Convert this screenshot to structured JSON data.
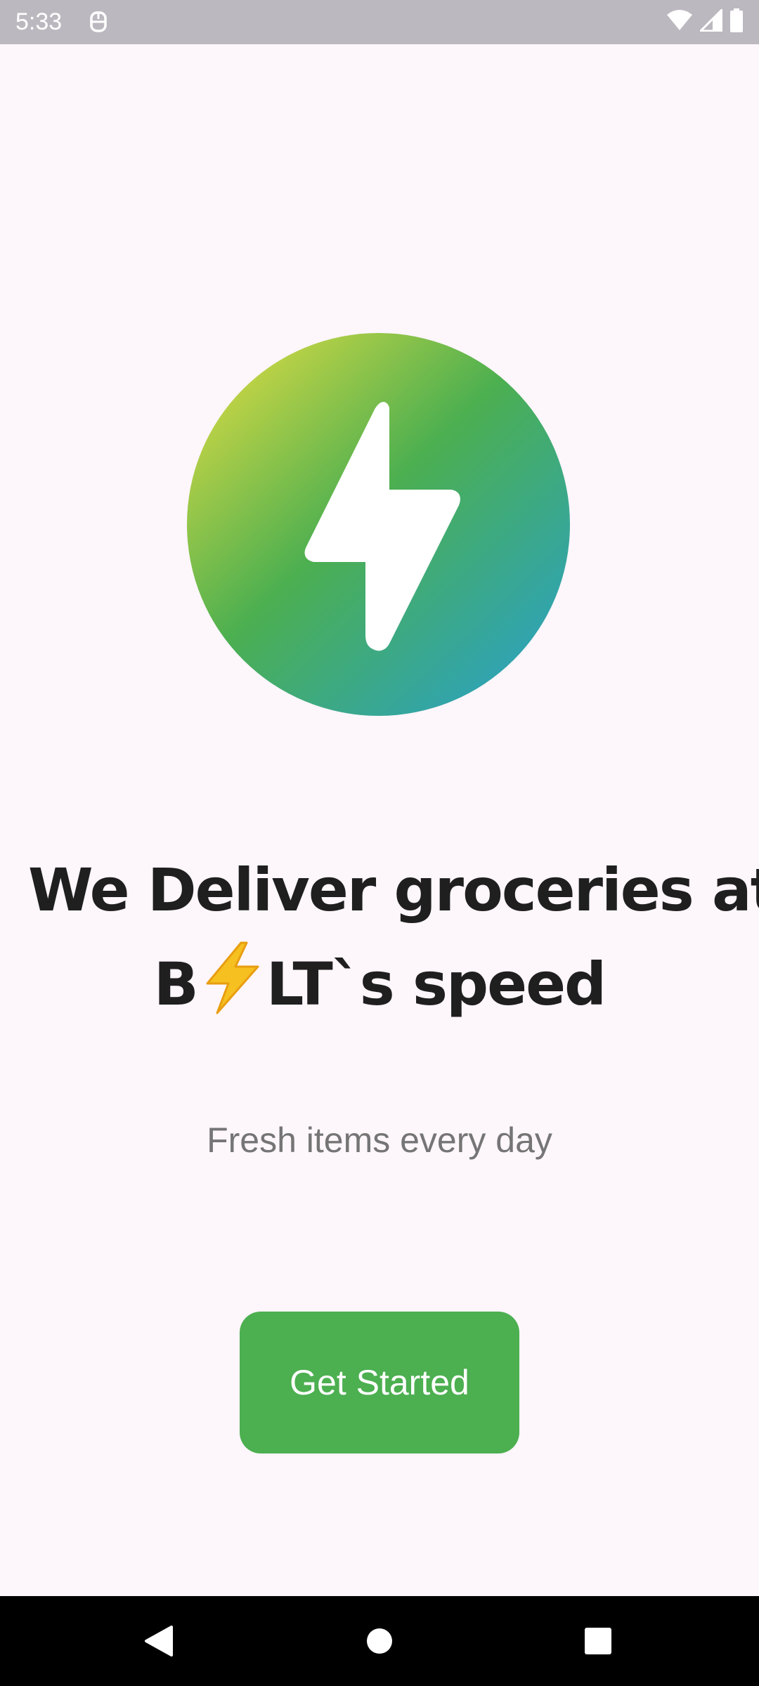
{
  "status_bar": {
    "time": "5:33",
    "icons": [
      "notification-app-icon",
      "wifi-icon",
      "signal-icon",
      "battery-icon"
    ]
  },
  "logo": {
    "icon": "lightning-bolt-icon",
    "gradient_colors": [
      "#c6d545",
      "#4caf50",
      "#2ea3b7"
    ]
  },
  "headline": {
    "line1": "We Deliver groceries at",
    "line2_prefix": "B",
    "line2_emoji": "⚡",
    "line2_suffix": "LT`s speed"
  },
  "subtitle": "Fresh items every day",
  "cta": {
    "label": "Get Started",
    "color": "#4caf50"
  },
  "nav_bar": {
    "buttons": [
      "back-icon",
      "home-icon",
      "recents-icon"
    ]
  }
}
